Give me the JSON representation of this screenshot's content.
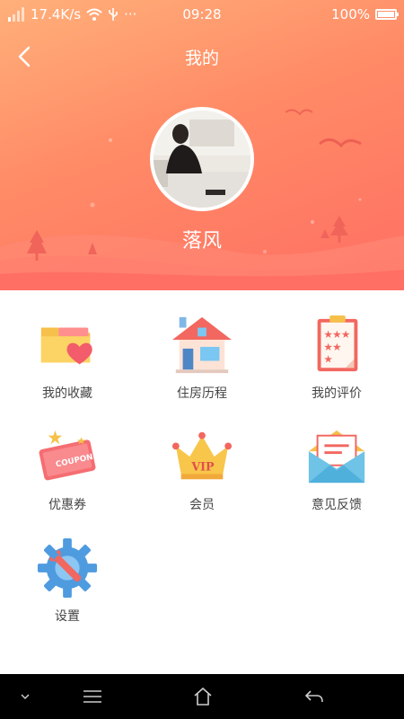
{
  "status_bar": {
    "network_speed": "17.4K/s",
    "time": "09:28",
    "battery_percent": "100%",
    "battery_level": 1.0
  },
  "header": {
    "title": "我的",
    "username": "落风"
  },
  "menu": [
    {
      "label": "我的收藏",
      "icon": "favorites-folder-heart-icon"
    },
    {
      "label": "住房历程",
      "icon": "house-icon"
    },
    {
      "label": "我的评价",
      "icon": "rating-clipboard-icon"
    },
    {
      "label": "优惠券",
      "icon": "coupon-icon"
    },
    {
      "label": "会员",
      "icon": "vip-crown-icon"
    },
    {
      "label": "意见反馈",
      "icon": "feedback-envelope-icon"
    },
    {
      "label": "设置",
      "icon": "settings-gear-icon"
    }
  ],
  "colors": {
    "header_gradient_top": "#ffb07a",
    "header_gradient_bottom": "#ff6f63",
    "label_text": "#444444"
  }
}
